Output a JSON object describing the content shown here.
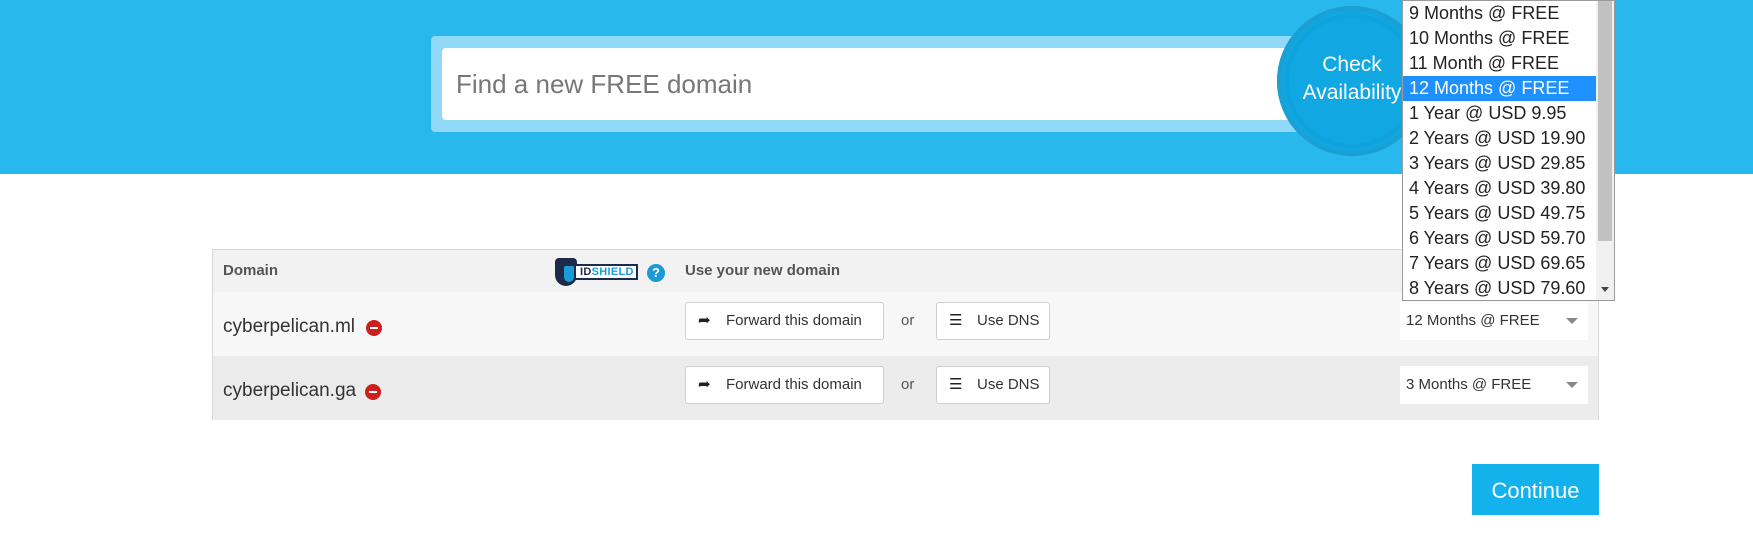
{
  "search": {
    "placeholder": "Find a new FREE domain",
    "button_line1": "Check",
    "button_line2": "Availability"
  },
  "table": {
    "headers": {
      "domain": "Domain",
      "use": "Use your new domain"
    },
    "brand": {
      "id": "ID",
      "shield": "SHIELD",
      "help": "?"
    },
    "rows": [
      {
        "domain": "cyberpelican.ml",
        "forward_label": "Forward this domain",
        "or": "or",
        "dns_label": "Use DNS",
        "period": "12 Months @ FREE"
      },
      {
        "domain": "cyberpelican.ga",
        "forward_label": "Forward this domain",
        "or": "or",
        "dns_label": "Use DNS",
        "period": "3 Months @ FREE"
      }
    ]
  },
  "dropdown": {
    "options": [
      "9 Months @ FREE",
      "10 Months @ FREE",
      "11 Month @ FREE",
      "12 Months @ FREE",
      "1 Year @ USD 9.95",
      "2 Years @ USD 19.90",
      "3 Years @ USD 29.85",
      "4 Years @ USD 39.80",
      "5 Years @ USD 49.75",
      "6 Years @ USD 59.70",
      "7 Years @ USD 69.65",
      "8 Years @ USD 79.60"
    ],
    "selected_index": 3
  },
  "continue_label": "Continue",
  "colors": {
    "hero": "#29b8ee",
    "accent": "#14b2ec",
    "selected": "#1e90ff",
    "remove": "#cc1f1f"
  }
}
